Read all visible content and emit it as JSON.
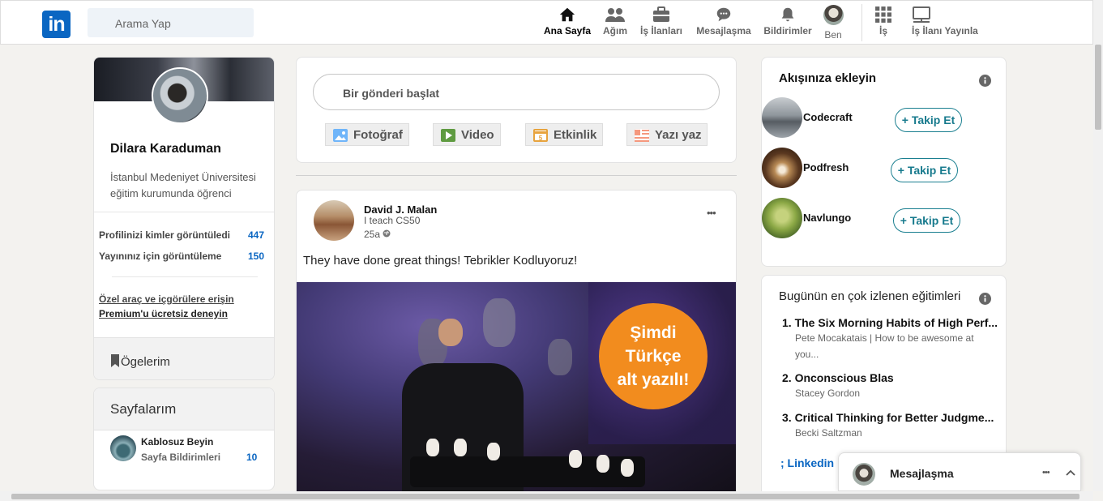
{
  "header": {
    "logo": "in",
    "search_placeholder": "Arama Yap",
    "nav": [
      {
        "label": "Ana Sayfa",
        "icon": "home-icon"
      },
      {
        "label": "Ağım",
        "icon": "network-icon"
      },
      {
        "label": "İş İlanları",
        "icon": "jobs-icon"
      },
      {
        "label": "Mesajlaşma",
        "icon": "messaging-icon"
      },
      {
        "label": "Bildirimler",
        "icon": "bell-icon"
      },
      {
        "label": "Ben",
        "icon": "avatar"
      },
      {
        "label": "İş",
        "icon": "grid-icon"
      },
      {
        "label": "İş İlanı Yayınla",
        "icon": "post-job-icon"
      }
    ]
  },
  "profile": {
    "name": "Dilara Karaduman",
    "headline": "İstanbul Medeniyet Üniversitesi eğitim kurumunda öğrenci",
    "stats": [
      {
        "label": "Profilinizi kimler görüntüledi",
        "value": "447"
      },
      {
        "label": "Yayınınız için görüntüleme",
        "value": "150"
      }
    ],
    "premium_line1": "Özel araç ve içgörülere erişin",
    "premium_line2": "Premium'u ücretsiz deneyin",
    "items_label": "Ögelerim"
  },
  "pages": {
    "title": "Sayfalarım",
    "item_name": "Kablosuz Beyin",
    "item_sub": "Sayfa Bildirimleri",
    "item_count": "10"
  },
  "composer": {
    "placeholder": "Bir gönderi başlat",
    "buttons": [
      "Fotoğraf",
      "Video",
      "Etkinlik",
      "Yazı yaz"
    ]
  },
  "post": {
    "author": "David J. Malan",
    "subtitle": "I teach CS50",
    "time": "25a",
    "more": "•••",
    "text": "They have done great things! Tebrikler Kodluyoruz!",
    "badge_lines": [
      "Şimdi",
      "Türkçe",
      "alt yazılı!"
    ]
  },
  "follow": {
    "title": "Akışınıza ekleyin",
    "items": [
      {
        "name": "Codecraft",
        "button": "+ Takip Et"
      },
      {
        "name": "Podfresh",
        "button": "+ Takip Et"
      },
      {
        "name": "Navlungo",
        "button": "+ Takip Et"
      }
    ]
  },
  "courses": {
    "title": "Bugünün en çok izlenen eğitimleri",
    "items": [
      {
        "title": "1. The Six Morning Habits of High Perf...",
        "sub1": "Pete Mocakatais | How to be awesome at",
        "sub2": "you..."
      },
      {
        "title": "2. Onconscious Blas",
        "sub1": "Stacey Gordon"
      },
      {
        "title": "3. Critical Thinking for Better Judgme...",
        "sub1": "Becki Saltzman"
      }
    ],
    "link": "; Linkedin"
  },
  "messaging": {
    "label": "Mesajlaşma",
    "more": "•••"
  }
}
